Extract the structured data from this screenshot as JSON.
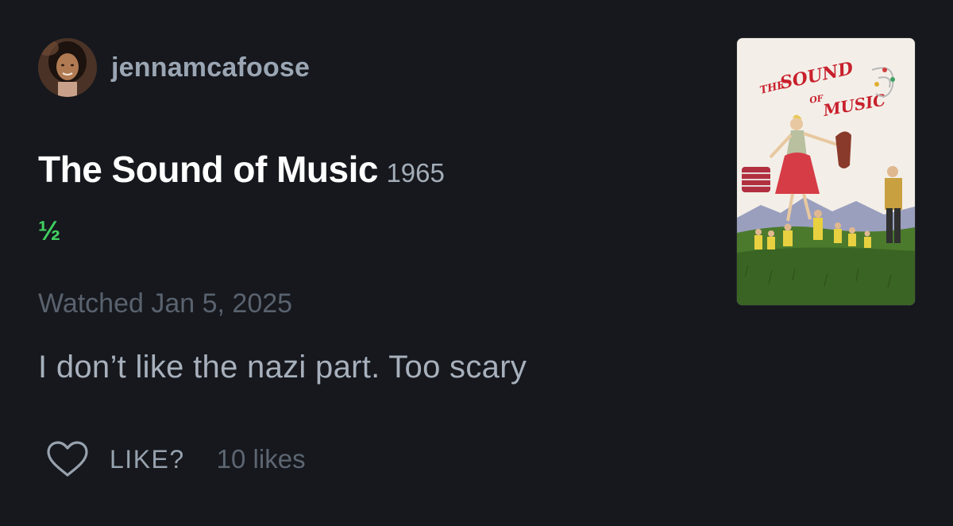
{
  "review": {
    "author": {
      "username": "jennamcafoose",
      "avatar_icon": "avatar-photo"
    },
    "film": {
      "title": "The Sound of Music",
      "year": "1965",
      "poster_icon": "film-poster"
    },
    "rating": {
      "text": "½",
      "stars": 0.5,
      "color": "#40d060"
    },
    "watched": "Watched Jan 5, 2025",
    "text": "I don’t like the nazi part. Too scary",
    "actions": {
      "like_icon": "heart-icon",
      "like_label": "LIKE?",
      "likes_count": "10 likes"
    }
  },
  "poster_title": {
    "the": "THE",
    "sound": "SOUND",
    "of": "OF",
    "music": "MUSIC"
  },
  "colors": {
    "background": "#16181d",
    "title": "#ffffff",
    "muted": "#59626e",
    "text": "#a7b0bc",
    "poster_title": "#c8202c"
  }
}
